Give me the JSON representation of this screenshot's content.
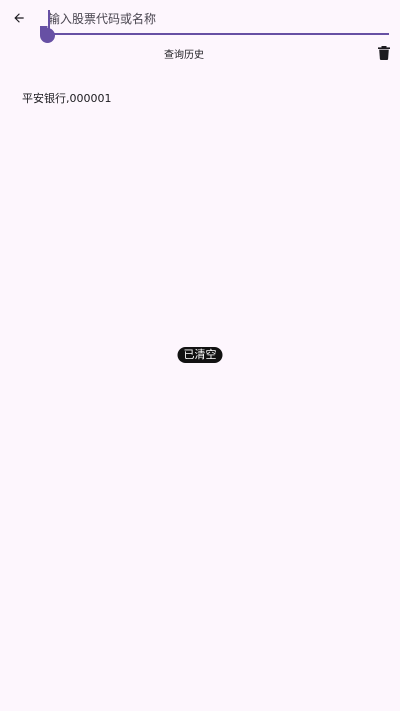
{
  "colors": {
    "background": "#fdf6fd",
    "accent": "#6750a4",
    "text": "#1c1b1f",
    "toast_background": "#121212",
    "toast_text": "#ffffff"
  },
  "toolbar": {
    "back_icon": "arrow-back-icon"
  },
  "search": {
    "placeholder": "输入股票代码或名称",
    "value": ""
  },
  "history": {
    "title": "查询历史",
    "delete_icon": "trash-icon",
    "items": [
      {
        "label": "平安银行,000001"
      }
    ]
  },
  "toast": {
    "message": "已清空"
  }
}
